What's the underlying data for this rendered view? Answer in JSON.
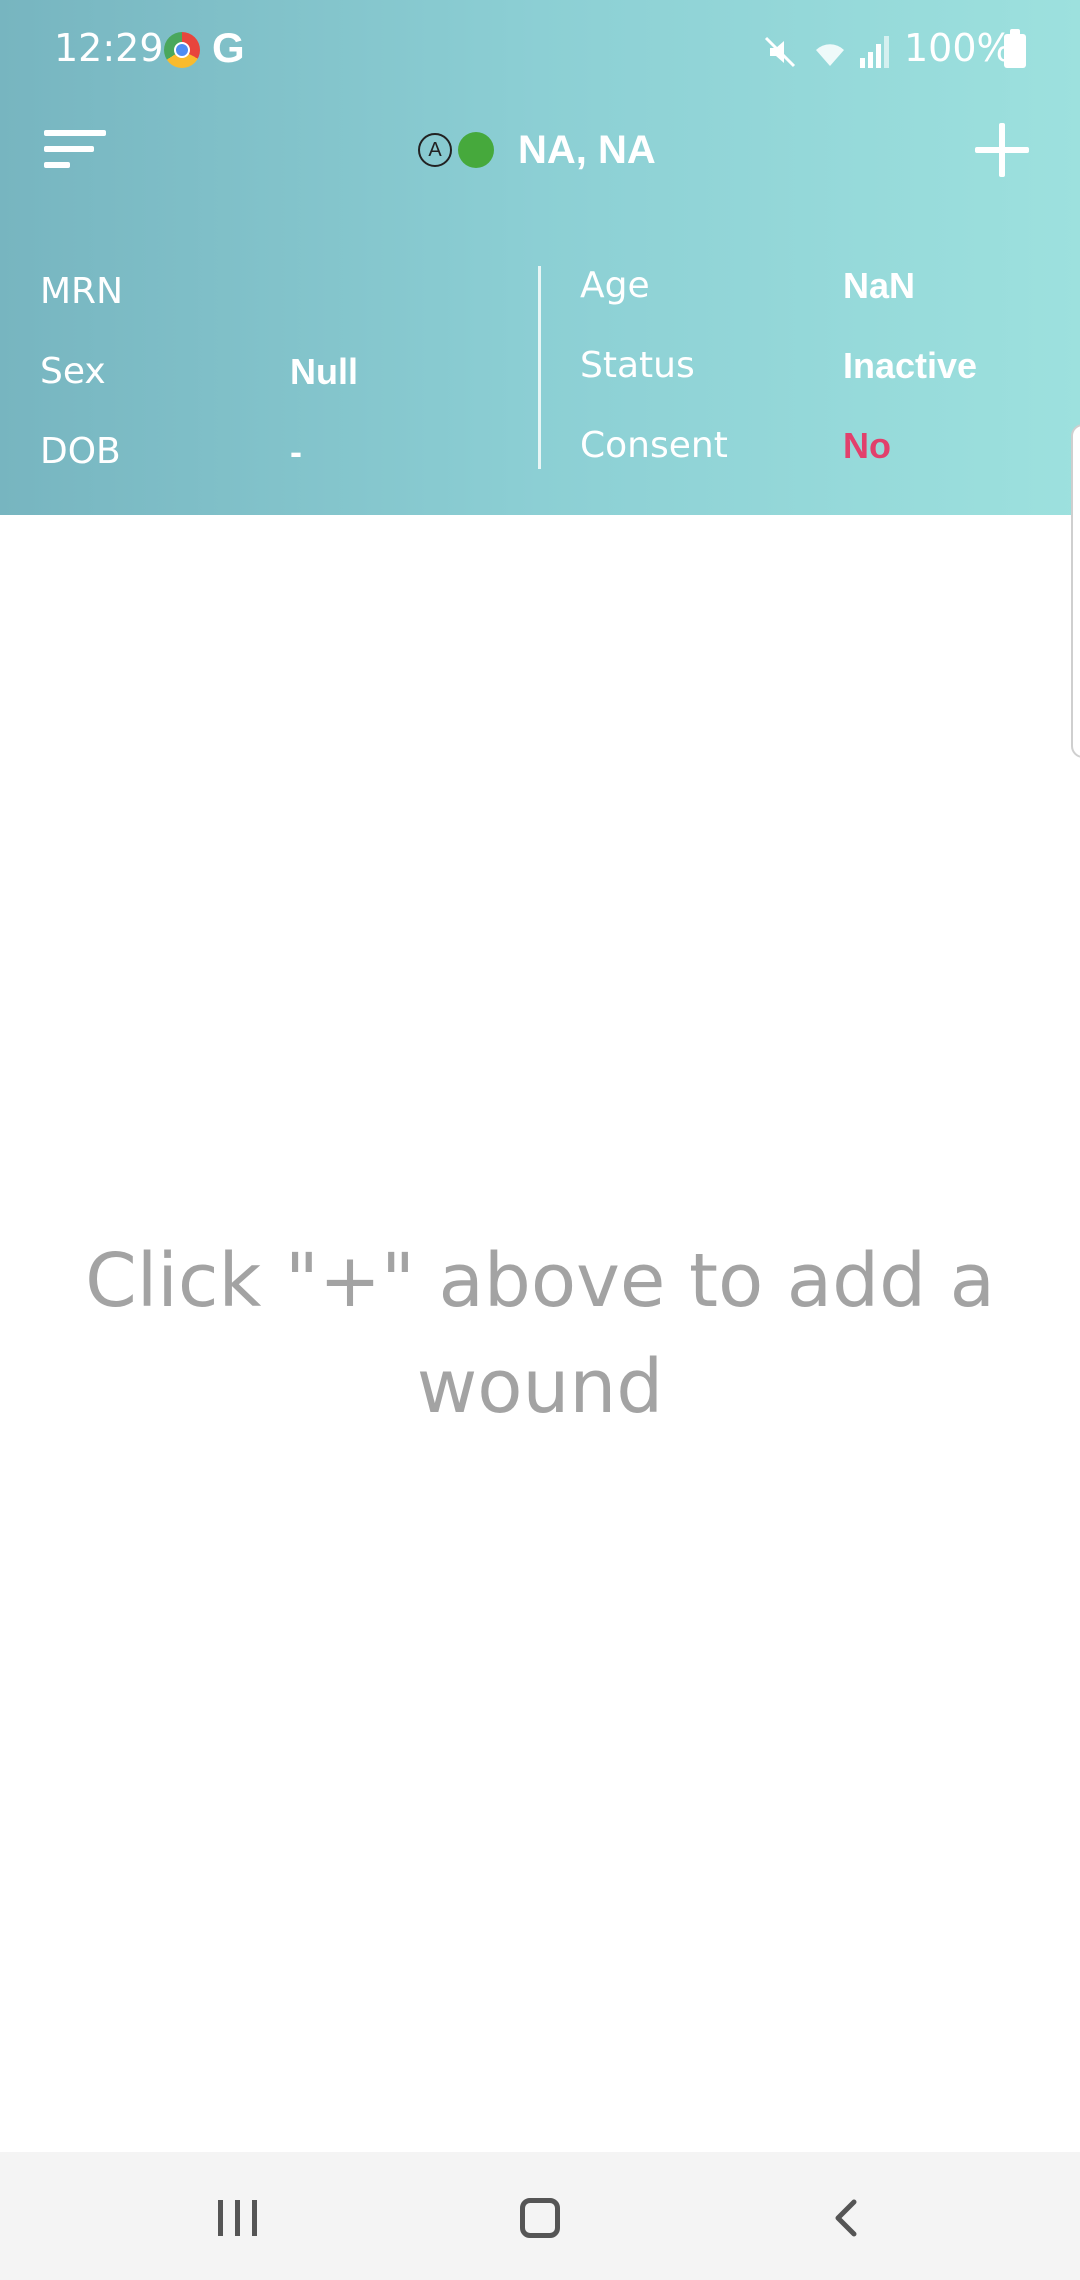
{
  "status_bar": {
    "time": "12:29",
    "battery": "100%",
    "icons": [
      "chrome-icon",
      "google-icon",
      "mute-icon",
      "wifi-icon",
      "signal-icon",
      "battery-icon"
    ]
  },
  "header": {
    "title": "NA, NA",
    "badge_letter": "A",
    "status_dot_color": "#46a93c"
  },
  "patient_info": {
    "left": [
      {
        "label": "MRN",
        "value": ""
      },
      {
        "label": "Sex",
        "value": "Null"
      },
      {
        "label": "DOB",
        "value": "-"
      }
    ],
    "right": [
      {
        "label": "Age",
        "value": "NaN"
      },
      {
        "label": "Status",
        "value": "Inactive"
      },
      {
        "label": "Consent",
        "value": "No"
      }
    ]
  },
  "main": {
    "empty_message": "Click \"+\" above to add a wound"
  },
  "colors": {
    "header_gradient_start": "#77b5c0",
    "header_gradient_end": "#9de1de",
    "consent_no": "#e2406c"
  }
}
